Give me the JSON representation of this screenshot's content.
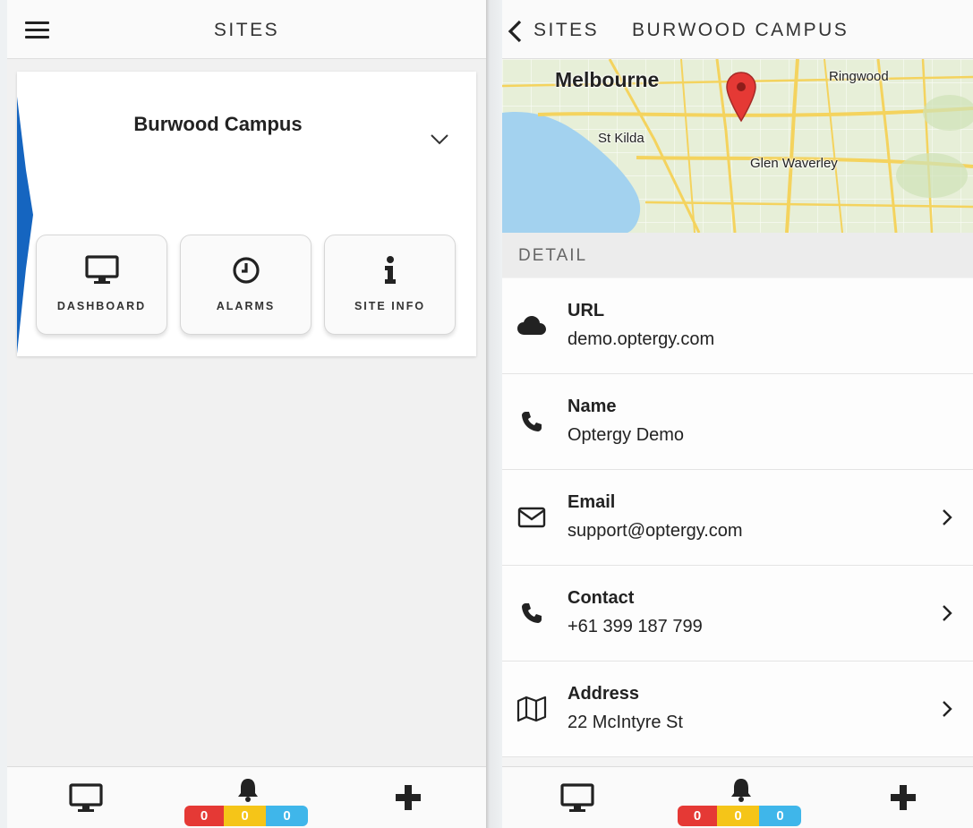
{
  "left_screen": {
    "header": {
      "title": "SITES",
      "menu_icon": "hamburger-menu-icon"
    },
    "site_card": {
      "name": "Burwood Campus",
      "accent_color": "#1565c0",
      "expand_icon": "chevron-down-icon",
      "actions": [
        {
          "label": "DASHBOARD",
          "icon": "monitor-icon"
        },
        {
          "label": "ALARMS",
          "icon": "clock-icon"
        },
        {
          "label": "SITE INFO",
          "icon": "info-icon"
        }
      ]
    }
  },
  "right_screen": {
    "header": {
      "back_label": "SITES",
      "title": "BURWOOD CAMPUS",
      "back_icon": "chevron-left-icon"
    },
    "map": {
      "labels": {
        "melbourne": "Melbourne",
        "ringwood": "Ringwood",
        "st_kilda": "St Kilda",
        "glen_waverley": "Glen Waverley"
      },
      "marker_color": "#e53935"
    },
    "detail": {
      "section_title": "DETAIL",
      "rows": [
        {
          "label": "URL",
          "value": "demo.optergy.com",
          "icon": "cloud-icon"
        },
        {
          "label": "Name",
          "value": "Optergy Demo",
          "icon": "phone-icon"
        },
        {
          "label": "Email",
          "value": "support@optergy.com",
          "icon": "envelope-icon"
        },
        {
          "label": "Contact",
          "value": "+61 399 187 799",
          "icon": "phone-icon"
        },
        {
          "label": "Address",
          "value": "22 McIntyre St",
          "icon": "map-icon"
        }
      ]
    }
  },
  "bottom_bar": {
    "icons": [
      "monitor-icon",
      "bell-icon",
      "plus-icon"
    ],
    "alarm_counts": {
      "red": "0",
      "yellow": "0",
      "blue": "0"
    },
    "colors": {
      "red": "#e53935",
      "yellow": "#f5c518",
      "blue": "#3fb6ea"
    }
  }
}
